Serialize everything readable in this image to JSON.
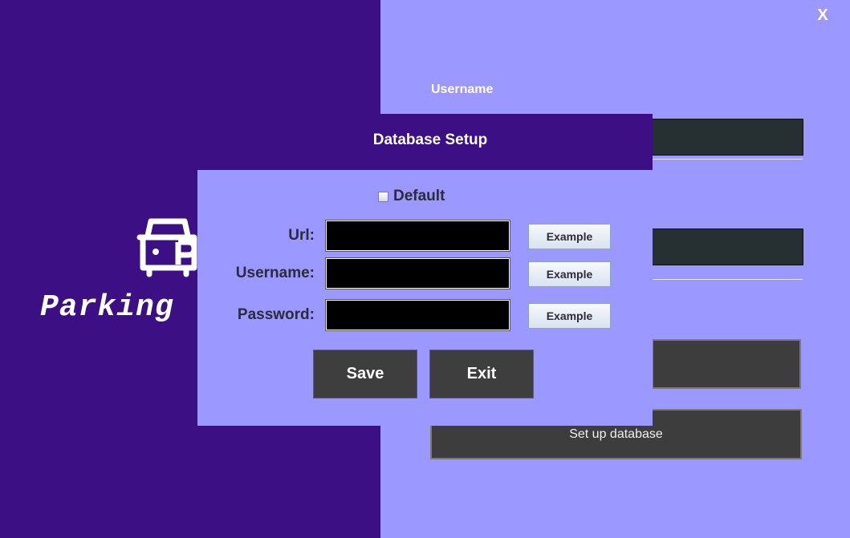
{
  "window": {
    "close_label": "X"
  },
  "brand": {
    "logo_icon": "parking-car-icon",
    "app_name_visible": "Parking"
  },
  "login": {
    "username_label": "Username",
    "setup_database_label": "Set up database"
  },
  "dialog": {
    "title": "Database Setup",
    "default_label": "Default",
    "default_checked": false,
    "fields": [
      {
        "label": "Url:",
        "value": "",
        "example_label": "Example"
      },
      {
        "label": "Username:",
        "value": "",
        "example_label": "Example"
      },
      {
        "label": "Password:",
        "value": "",
        "example_label": "Example"
      }
    ],
    "save_label": "Save",
    "exit_label": "Exit"
  },
  "colors": {
    "primary_purple": "#3c0f84",
    "panel_lavender": "#9b98ff",
    "button_dark": "#3e3e3e",
    "input_black": "#000000"
  }
}
